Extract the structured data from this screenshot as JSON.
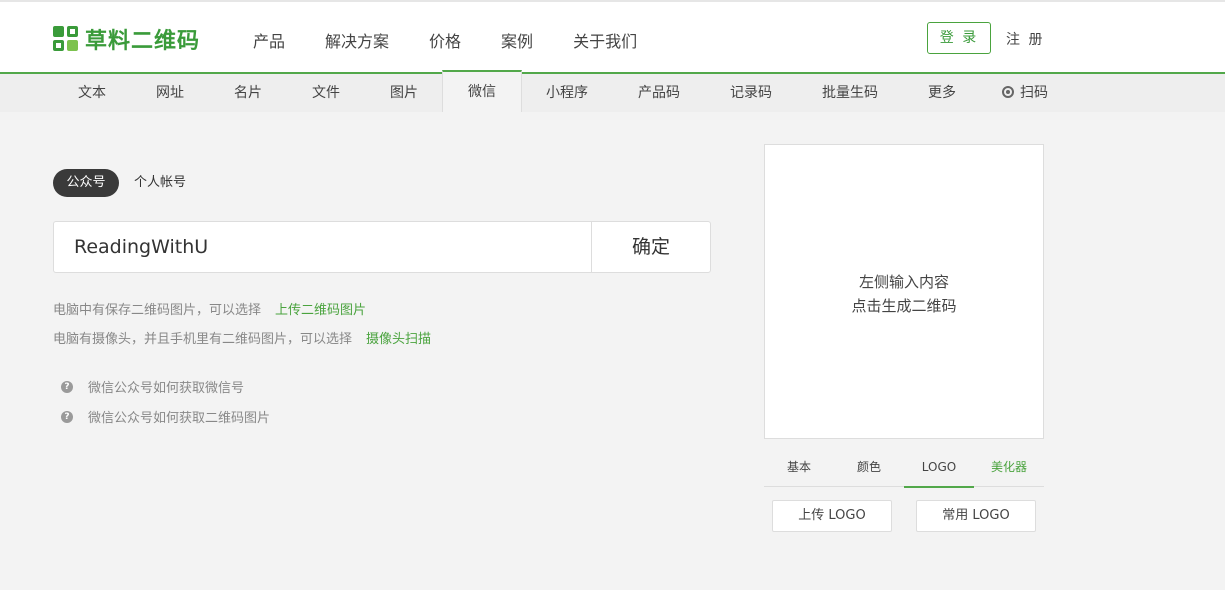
{
  "header": {
    "logo_text": "草料二维码",
    "nav": [
      "产品",
      "解决方案",
      "价格",
      "案例",
      "关于我们"
    ],
    "login_label": "登 录",
    "register_label": "注 册"
  },
  "subnav": {
    "tabs": [
      "文本",
      "网址",
      "名片",
      "文件",
      "图片",
      "微信",
      "小程序",
      "产品码",
      "记录码",
      "批量生码",
      "更多",
      "扫码"
    ],
    "active": "微信"
  },
  "main": {
    "segment": {
      "active": "公众号",
      "inactive": "个人帐号"
    },
    "input_value": "ReadingWithU",
    "confirm_label": "确定",
    "hints": [
      {
        "text": "电脑中有保存二维码图片，可以选择",
        "link": "上传二维码图片"
      },
      {
        "text": "电脑有摄像头，并且手机里有二维码图片，可以选择",
        "link": "摄像头扫描"
      }
    ],
    "help_links": [
      "微信公众号如何获取微信号",
      "微信公众号如何获取二维码图片"
    ]
  },
  "preview": {
    "line1": "左侧输入内容",
    "line2": "点击生成二维码",
    "tabs": [
      "基本",
      "颜色",
      "LOGO",
      "美化器"
    ],
    "active_tab": "LOGO",
    "buttons": [
      "上传 LOGO",
      "常用 LOGO"
    ]
  },
  "colors": {
    "brand_green": "#52a84a",
    "dark_pill": "#3a3a3a"
  }
}
